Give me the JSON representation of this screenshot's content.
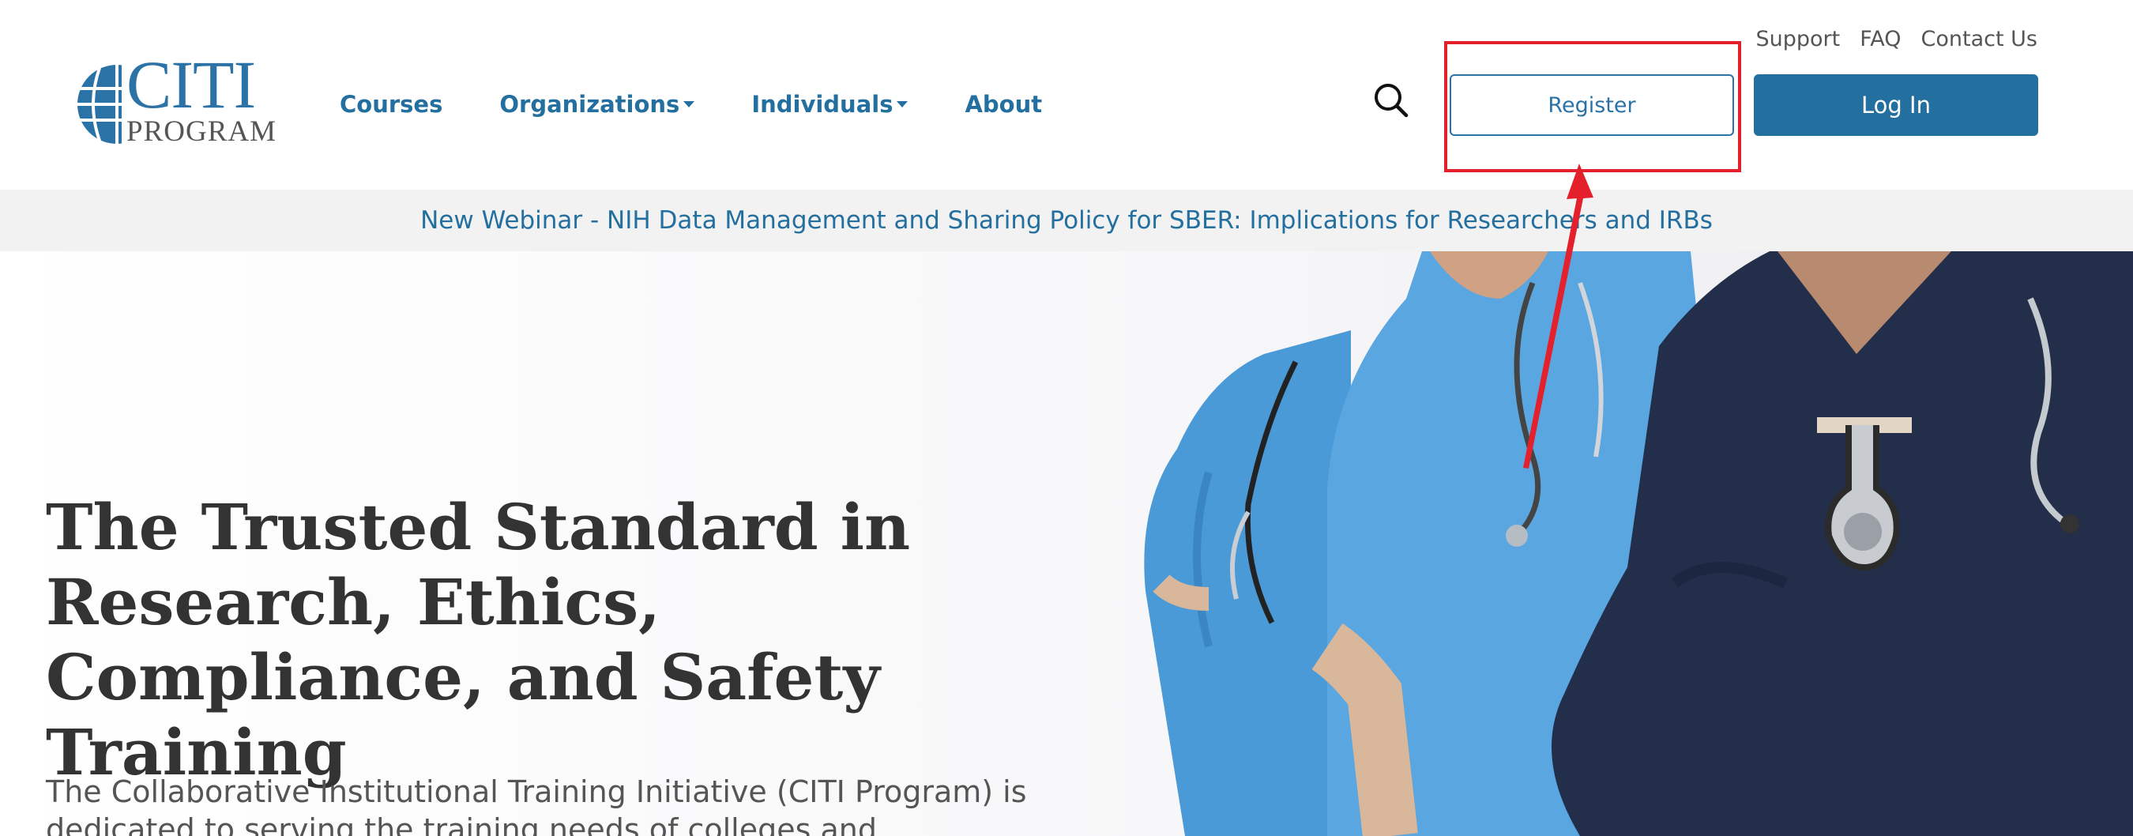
{
  "logo": {
    "citi": "CITI",
    "program": "PROGRAM"
  },
  "nav": {
    "items": [
      {
        "label": "Courses",
        "dropdown": false
      },
      {
        "label": "Organizations",
        "dropdown": true
      },
      {
        "label": "Individuals",
        "dropdown": true
      },
      {
        "label": "About",
        "dropdown": false
      }
    ]
  },
  "utility": {
    "support": "Support",
    "faq": "FAQ",
    "contact": "Contact Us"
  },
  "actions": {
    "register": "Register",
    "login": "Log In"
  },
  "banner": {
    "text": "New Webinar - NIH Data Management and Sharing Policy for SBER: Implications for Researchers and IRBs"
  },
  "hero": {
    "title": "The Trusted Standard in Research, Ethics, Compliance, and Safety Training",
    "description": "The Collaborative Institutional Training Initiative (CITI Program) is dedicated to serving the training needs of colleges and"
  },
  "colors": {
    "brand": "#236f9f",
    "annotation": "#e4202d"
  },
  "icons": {
    "search": "search-icon",
    "caret": "caret-down-icon",
    "logo": "globe-icon"
  }
}
